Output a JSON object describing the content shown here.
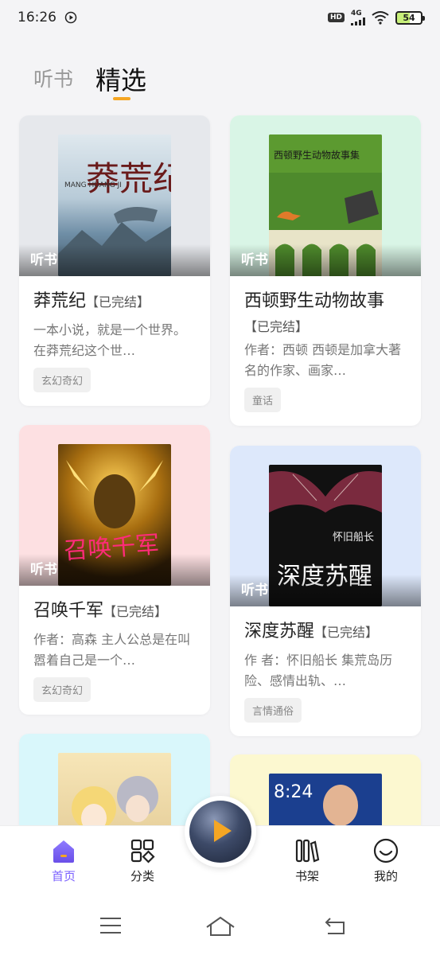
{
  "status_bar": {
    "time": "16:26",
    "hd": "HD",
    "network": "4G",
    "battery": "54"
  },
  "tabs": {
    "listen": "听书",
    "featured": "精选"
  },
  "cards": [
    {
      "listen": "听书",
      "title": "莽荒纪",
      "status": "【已完结】",
      "desc": "一本小说，就是一个世界。在莽荒纪这个世…",
      "genre": "玄幻奇幻",
      "bg": "#e6e8ec",
      "cover_title": "莽荒纪",
      "cover_pinyin": "MANG HUANG JI"
    },
    {
      "listen": "听书",
      "title": "西顿野生动物故事",
      "status": "【已完结】",
      "desc": "作者：西顿 西顿是加拿大著名的作家、画家…",
      "genre": "童话",
      "bg": "#d9f5e6",
      "cover_title": "西顿野生动物故事集"
    },
    {
      "listen": "听书",
      "title": "召唤千军",
      "status": "【已完结】",
      "desc": "作者：高森 主人公总是在叫嚣着自己是一个…",
      "genre": "玄幻奇幻",
      "bg": "#fde0e2",
      "cover_title": "召唤千军"
    },
    {
      "listen": "听书",
      "title": "深度苏醒",
      "status": "【已完结】",
      "desc": "作 者：怀旧船长 集荒岛历险、感情出轨、…",
      "genre": "言情通俗",
      "bg": "#dde8fb",
      "cover_title": "深度苏醒",
      "cover_author": "怀旧船长"
    },
    {
      "bg": "#d9f7fb"
    },
    {
      "bg": "#fcf8d0"
    }
  ],
  "bottom_nav": {
    "home": "首页",
    "category": "分类",
    "shelf": "书架",
    "mine": "我的"
  },
  "colors": {
    "accent": "#7b61ff",
    "underline": "#f5a623"
  }
}
